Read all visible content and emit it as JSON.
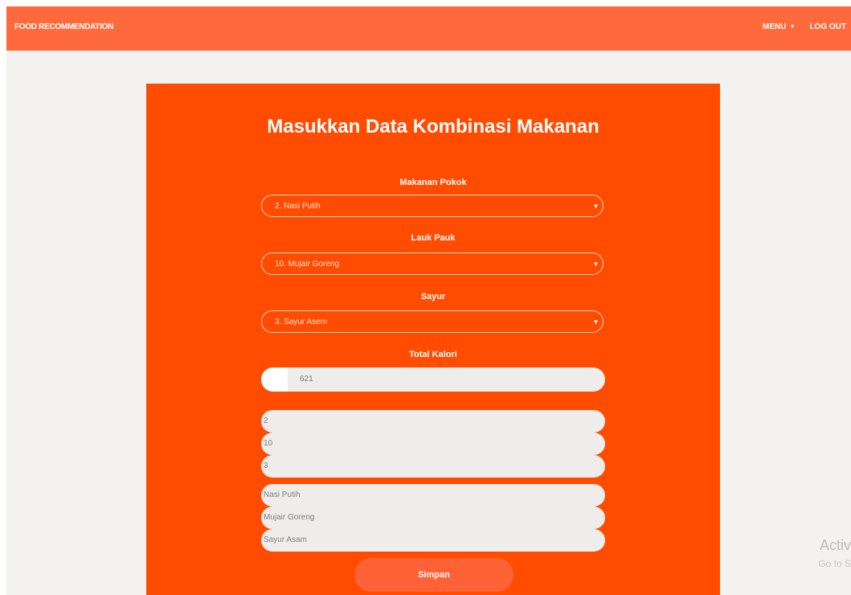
{
  "navbar": {
    "brand": "FOOD RECOMMENDATION",
    "menu_label": "MENU",
    "logout_label": "LOG OUT"
  },
  "form": {
    "title": "Masukkan Data Kombinasi Makanan",
    "makanan_pokok": {
      "label": "Makanan Pokok",
      "selected": "2. Nasi Putih"
    },
    "lauk_pauk": {
      "label": "Lauk Pauk",
      "selected": "10. Mujair Goreng"
    },
    "sayur": {
      "label": "Sayur",
      "selected": "3. Sayur Asem"
    },
    "total_kalori": {
      "label": "Total Kalori",
      "value": "621"
    },
    "hidden_fields": [
      "2",
      "10",
      "3",
      "Nasi Putih",
      "Mujair Goreng",
      "Sayur Asam"
    ],
    "submit_label": "Simpan"
  },
  "watermark": {
    "activate_text": "Activ",
    "goto_text": "Go to S"
  },
  "colors": {
    "navbar": "#fe6a3c",
    "card": "#ff4c00",
    "button": "#ff6236",
    "field_bg": "#eeedec"
  }
}
